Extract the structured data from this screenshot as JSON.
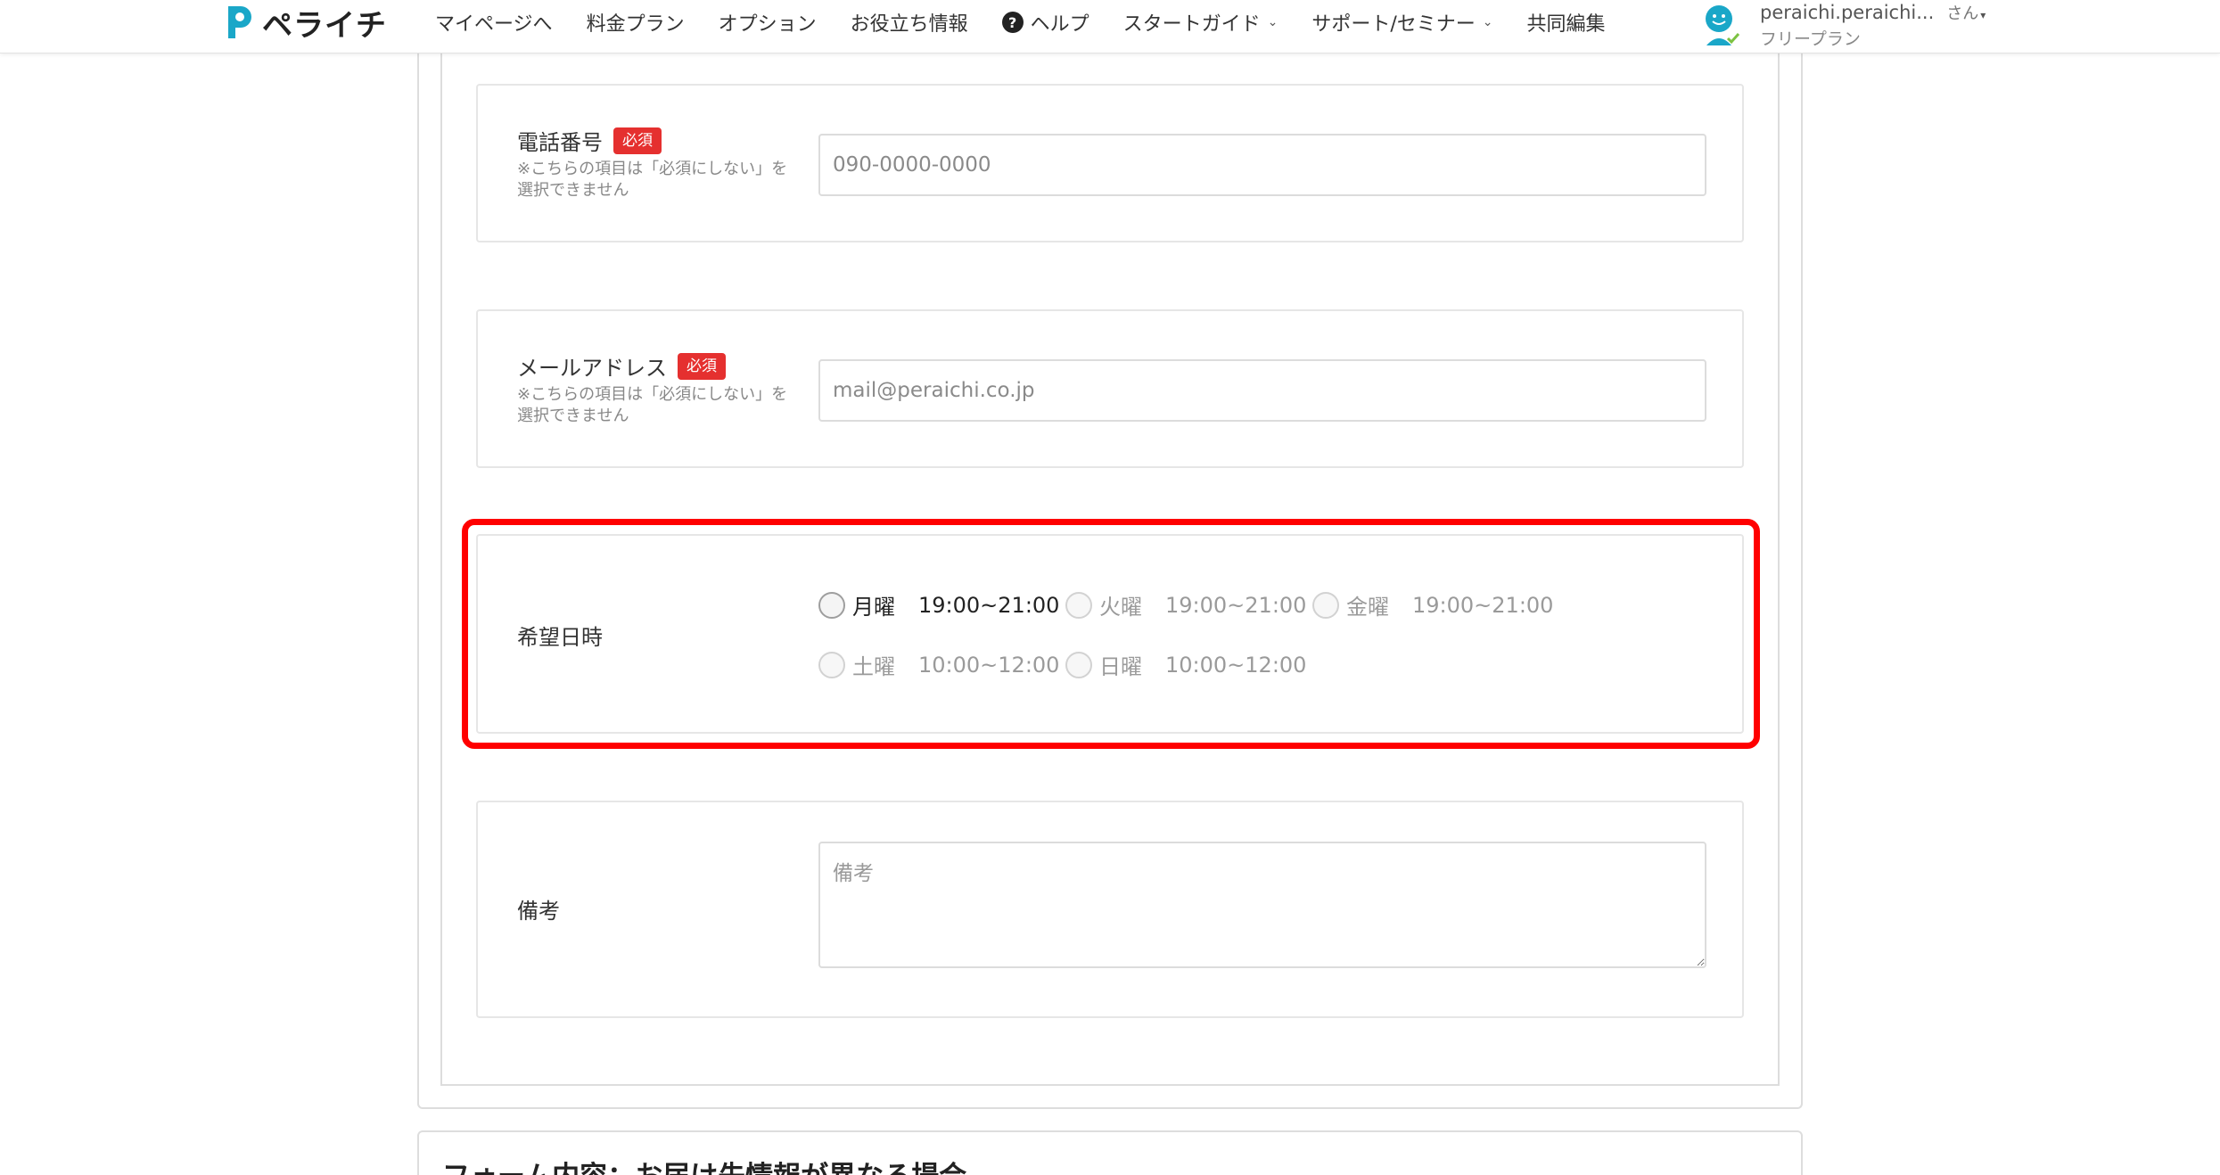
{
  "header": {
    "logo_text": "ペライチ",
    "nav": [
      {
        "label": "マイページへ"
      },
      {
        "label": "料金プラン"
      },
      {
        "label": "オプション"
      },
      {
        "label": "お役立ち情報"
      },
      {
        "label": "ヘルプ",
        "icon": "question-circle-icon"
      },
      {
        "label": "スタートガイド",
        "dropdown": true
      },
      {
        "label": "サポート/セミナー",
        "dropdown": true
      },
      {
        "label": "共同編集"
      }
    ],
    "help_glyph": "?",
    "chevron_glyph": "⌄",
    "user": {
      "name": "peraichi.peraichi...",
      "suffix": "さん",
      "caret": "▾",
      "plan": "フリープラン"
    }
  },
  "form": {
    "phone": {
      "label": "電話番号",
      "badge": "必須",
      "note": "※こちらの項目は「必須にしない」を選択できません",
      "placeholder": "090-0000-0000"
    },
    "email": {
      "label": "メールアドレス",
      "badge": "必須",
      "note": "※こちらの項目は「必須にしない」を選択できません",
      "placeholder": "mail@peraichi.co.jp"
    },
    "datetime": {
      "label": "希望日時",
      "options": [
        {
          "day": "月曜",
          "time": "19:00~21:00",
          "enabled": true
        },
        {
          "day": "火曜",
          "time": "19:00~21:00",
          "enabled": false
        },
        {
          "day": "金曜",
          "time": "19:00~21:00",
          "enabled": false
        },
        {
          "day": "土曜",
          "time": "10:00~12:00",
          "enabled": false
        },
        {
          "day": "日曜",
          "time": "10:00~12:00",
          "enabled": false
        }
      ]
    },
    "remarks": {
      "label": "備考",
      "placeholder": "備考"
    }
  },
  "next_section": {
    "title": "フォーム内容：お届け先情報が異なる場合"
  },
  "colors": {
    "highlight": "#ff0000",
    "required_badge": "#e5302f",
    "brand": "#1aa7c8"
  }
}
